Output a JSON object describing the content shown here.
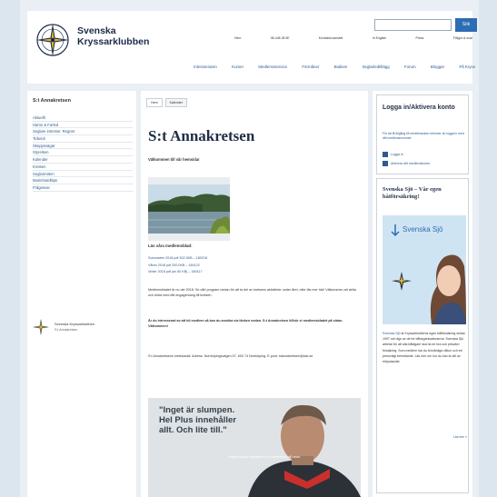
{
  "header": {
    "brand_line1": "Svenska",
    "brand_line2": "Kryssarklubben",
    "search_button": "Sök",
    "search_placeholder": "",
    "top_links": [
      "Hem",
      "08-448 28 80",
      "Kontakta kansliet",
      "In English",
      "Press",
      "Frågor & svar"
    ],
    "main_nav": [
      "Intresseraren",
      "Kurser",
      "Medlemsservice",
      "Förmåner",
      "Butiken",
      "Seglarledtillägg",
      "Forum",
      "Bloggar",
      "På Kryss"
    ]
  },
  "sidebar": {
    "title": "S:t Annakretsen",
    "items": [
      "Aktuellt",
      "Hamn & Farled",
      "Seglare intresse: Regnet",
      "Tidwick",
      "Skeppsvägar",
      "Styrelsen",
      "Kalender",
      "Kretsen",
      "Seglarmöten",
      "Marinhotelltips",
      "Frågesvar"
    ],
    "org_name": "Svenska Kryssarklubben",
    "org_sub": "S:t Annakretsen"
  },
  "content": {
    "tabs": [
      "Hem",
      "Kalender"
    ],
    "title": "S:t Annakretsen",
    "welcome": "Välkommen till vår hemsida!",
    "caption": "Läs våra medlemsblad:",
    "dates": [
      "Sommaren 2018 pdf 302.0KB – 180218",
      "Våren 2018 pdf 200.0KB – 180122",
      "Vinter 2018 pdf (av 60 KB) – 180117"
    ],
    "para1": "Medlemsbladet är nu ute 2018. Se vårt program nedan för att ta del av kretsens aktiviteter under året, eller läs mer här! Välkommen att delta och bidra med ditt engagemang till kretsen.",
    "para2": "Är du intresserad av att bli medlem så kan du ansöka via länken nedan. S:t Annakretsen tillhör vi medlemsbladet på sidan. Välkommen!",
    "para3": "S:t Annakretsens kretskansli: Adress: Norrköpingsvägen 57, 603 74 Norrköping. E-post: stannakretsen@ssk.se",
    "ad_line1": "\"Inget är slumpen.",
    "ad_line2": "Hel Plus innehåller",
    "ad_line3": "allt. Och lite till.\"",
    "ad_small": "Seglare sedan barnsben och fortfarande på havet"
  },
  "right": {
    "login_title": "Logga in/Aktivera konto",
    "login_desc": "För att få tillgång till medlemssidor behöver du logga in med ditt medlemsnummer.",
    "login_link": "Logga in",
    "activate_link": "Aktivera ditt medlemskonto",
    "promo_title": "Svenska Sjö – Vår egen båtförsäkring!",
    "promo_brand": "Svenska Sjö",
    "promo_text_link": "Svenska Sjö",
    "promo_text": " är Kryssarklubbens egen båtförsäkring sedan 1997 och ägs av de tre båtorganisationerna. Svenska Sjö arbetar för att alla båtägare ska ha en bra och prisvärd försäkring. Som medlem har du förmånliga villkor och ett personligt bemötande. Läs mer om hur du kan ta del av erbjudandet.",
    "promo_more": "Läs mer »"
  },
  "colors": {
    "accent": "#2d6db3",
    "link": "#2d5b8f",
    "heading": "#1f2e45"
  }
}
